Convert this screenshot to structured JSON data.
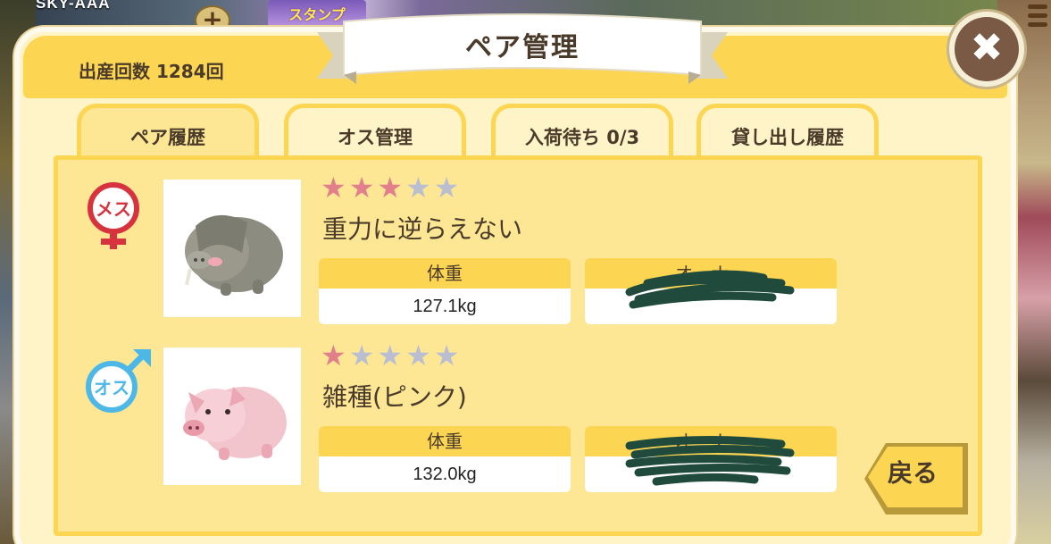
{
  "background": {
    "user_name": "SKY-AAA",
    "plus_label": "+",
    "banner_text": "スタンプ"
  },
  "dialog": {
    "title": "ペア管理",
    "birth_count_label": "出産回数 1284回",
    "close_label": "✖",
    "back_label": "戻る"
  },
  "tabs": [
    {
      "label": "ペア履歴",
      "active": true
    },
    {
      "label": "オス管理",
      "active": false
    },
    {
      "label": "入荷待ち 0/3",
      "active": false
    },
    {
      "label": "貸し出し履歴",
      "active": false
    }
  ],
  "pigs": [
    {
      "gender": "メス",
      "gender_color": "#d7333f",
      "stars_filled": 3,
      "stars_total": 5,
      "name": "重力に逆らえない",
      "weight_label": "体重",
      "weight_value": "127.1kg",
      "owner_label": "オーナー",
      "owner_value": "",
      "body_color": "#8d8c80"
    },
    {
      "gender": "オス",
      "gender_color": "#4db8e8",
      "stars_filled": 1,
      "stars_total": 5,
      "name": "雑種(ピンク)",
      "weight_label": "体重",
      "weight_value": "132.0kg",
      "owner_label": "オーナー",
      "owner_value": "",
      "body_color": "#f2c4cc"
    }
  ],
  "colors": {
    "header_yellow": "#fcd553",
    "panel_cream": "#fff4c8",
    "content_yellow": "#fde795",
    "star_on": "#e17f8a",
    "star_off": "#b9bfd0",
    "close_brown": "#7b5a45",
    "scribble": "#1f4a3c"
  }
}
